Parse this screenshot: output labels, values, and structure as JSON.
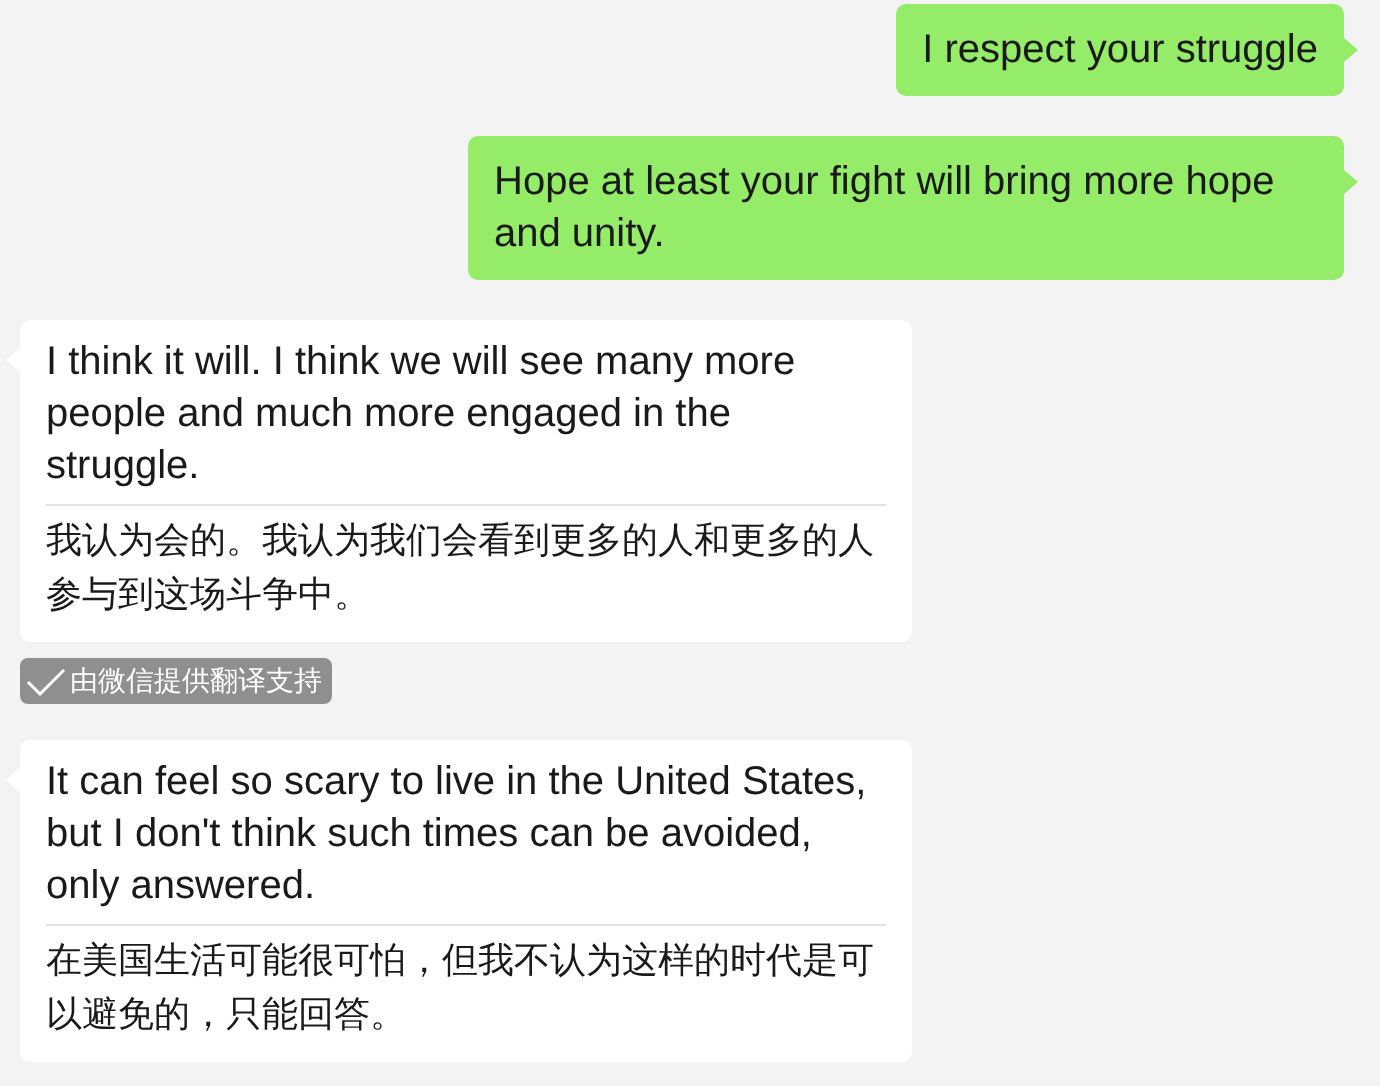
{
  "messages": [
    {
      "kind": "sent",
      "text": "I respect your struggle"
    },
    {
      "kind": "sent",
      "text": "Hope at least your fight will bring more hope and unity."
    },
    {
      "kind": "received",
      "text": "I think it will. I think we will see many more people and much more engaged in the struggle.",
      "translation": "我认为会的。我认为我们会看到更多的人和更多的人参与到这场斗争中。"
    },
    {
      "kind": "note",
      "text": "由微信提供翻译支持"
    },
    {
      "kind": "received",
      "text": "It can feel so scary to live in the United States, but I don't think such times can be avoided, only answered.",
      "translation": "在美国生活可能很可怕，但我不认为这样的时代是可以避免的，只能回答。"
    }
  ]
}
